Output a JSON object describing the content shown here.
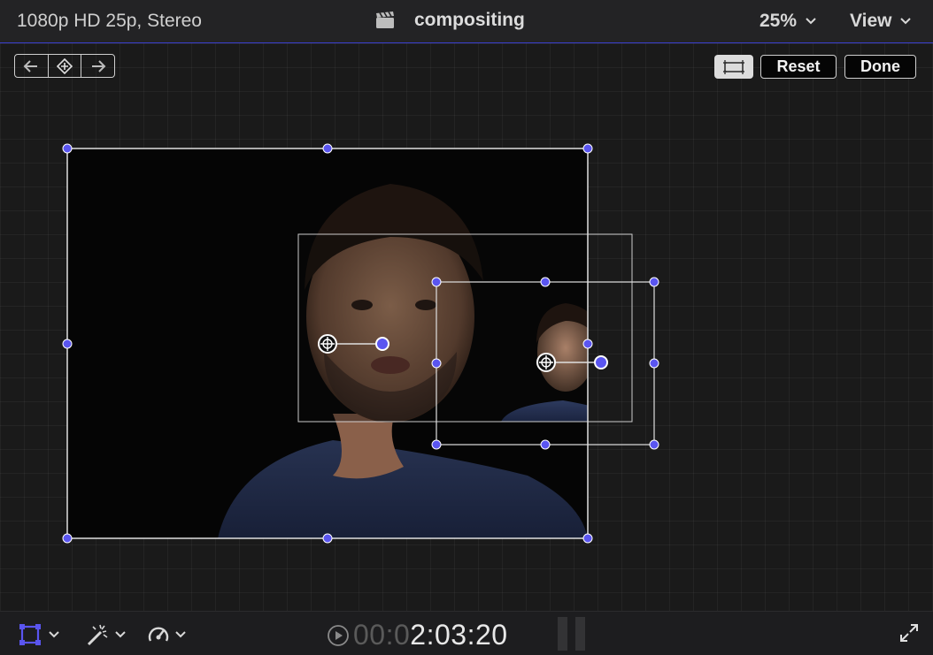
{
  "header": {
    "format": "1080p HD 25p, Stereo",
    "project_title": "compositing",
    "zoom_level": "25%",
    "view_menu": "View"
  },
  "onscreen_controls": {
    "reset_label": "Reset",
    "done_label": "Done"
  },
  "timecode": {
    "dim_part": "00:0",
    "main_part": "2:03:20"
  },
  "colors": {
    "handle": "#5a55f0",
    "accent_line": "#3b3fd0",
    "frame_line": "#e0e0e0"
  },
  "icons": {
    "clapper": "clapperboard-icon",
    "prev_keyframe": "previous-keyframe-icon",
    "add_keyframe": "add-keyframe-icon",
    "next_keyframe": "next-keyframe-icon",
    "transform": "transform-icon",
    "enhance": "magic-wand-icon",
    "speed": "speedometer-icon",
    "playback": "play-circle-icon",
    "fullscreen": "fullscreen-icon"
  }
}
